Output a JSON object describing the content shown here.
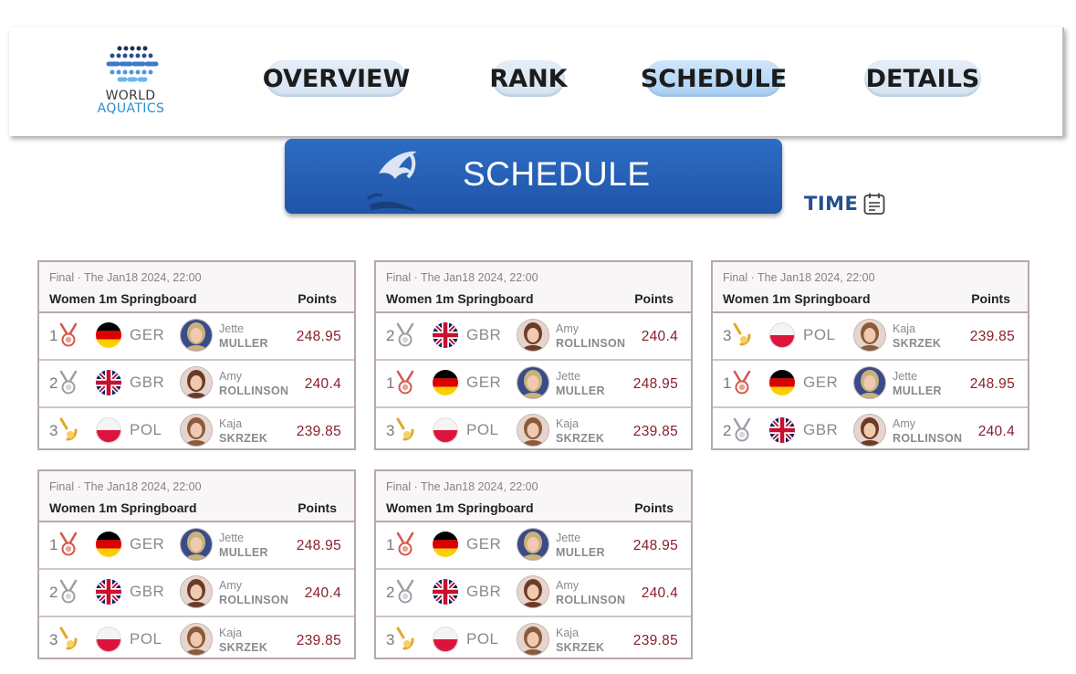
{
  "header": {
    "logo_line1": "WORLD",
    "logo_line2": "AQUATICS",
    "nav": [
      {
        "label": "OVERVIEW",
        "active": false
      },
      {
        "label": "RANK",
        "active": false
      },
      {
        "label": "SCHEDULE",
        "active": true
      },
      {
        "label": "DETAILS",
        "active": false
      }
    ]
  },
  "banner": {
    "title": "SCHEDULE",
    "icon": "swimmer-logo-icon"
  },
  "sort": {
    "label": "TIME",
    "icon": "calendar-icon"
  },
  "colors": {
    "banner_blue": "#2461b6",
    "score_red": "#8a1f2c",
    "link_blue": "#24508e",
    "logo_blue": "#2a8fd6"
  },
  "cards": [
    {
      "meta": "Final · The Jan18 2024, 22:00",
      "event": "Women 1m Springboard",
      "points_header": "Points",
      "rows": [
        {
          "rank": "1",
          "medal": "bronze-medal-icon",
          "country": "GER",
          "first": "Jette",
          "last": "MULLER",
          "score": "248.95"
        },
        {
          "rank": "2",
          "medal": "silver-medal-icon",
          "country": "GBR",
          "first": "Amy",
          "last": "ROLLINSON",
          "score": "240.4"
        },
        {
          "rank": "3",
          "medal": "gold-medal-icon",
          "country": "POL",
          "first": "Kaja",
          "last": "SKRZEK",
          "score": "239.85"
        }
      ]
    },
    {
      "meta": "Final · The Jan18 2024, 22:00",
      "event": "Women 1m Springboard",
      "points_header": "Points",
      "rows": [
        {
          "rank": "2",
          "medal": "silver-medal-icon",
          "country": "GBR",
          "first": "Amy",
          "last": "ROLLINSON",
          "score": "240.4"
        },
        {
          "rank": "1",
          "medal": "bronze-medal-icon",
          "country": "GER",
          "first": "Jette",
          "last": "MULLER",
          "score": "248.95"
        },
        {
          "rank": "3",
          "medal": "gold-medal-icon",
          "country": "POL",
          "first": "Kaja",
          "last": "SKRZEK",
          "score": "239.85"
        }
      ]
    },
    {
      "meta": "Final · The Jan18 2024, 22:00",
      "event": "Women 1m Springboard",
      "points_header": "Points",
      "rows": [
        {
          "rank": "3",
          "medal": "gold-medal-icon",
          "country": "POL",
          "first": "Kaja",
          "last": "SKRZEK",
          "score": "239.85"
        },
        {
          "rank": "1",
          "medal": "bronze-medal-icon",
          "country": "GER",
          "first": "Jette",
          "last": "MULLER",
          "score": "248.95"
        },
        {
          "rank": "2",
          "medal": "silver-medal-icon",
          "country": "GBR",
          "first": "Amy",
          "last": "ROLLINSON",
          "score": "240.4"
        }
      ]
    },
    {
      "meta": "Final · The Jan18 2024, 22:00",
      "event": "Women 1m Springboard",
      "points_header": "Points",
      "rows": [
        {
          "rank": "1",
          "medal": "bronze-medal-icon",
          "country": "GER",
          "first": "Jette",
          "last": "MULLER",
          "score": "248.95"
        },
        {
          "rank": "2",
          "medal": "silver-medal-icon",
          "country": "GBR",
          "first": "Amy",
          "last": "ROLLINSON",
          "score": "240.4"
        },
        {
          "rank": "3",
          "medal": "gold-medal-icon",
          "country": "POL",
          "first": "Kaja",
          "last": "SKRZEK",
          "score": "239.85"
        }
      ]
    },
    {
      "meta": "Final · The Jan18 2024, 22:00",
      "event": "Women 1m Springboard",
      "points_header": "Points",
      "rows": [
        {
          "rank": "1",
          "medal": "bronze-medal-icon",
          "country": "GER",
          "first": "Jette",
          "last": "MULLER",
          "score": "248.95"
        },
        {
          "rank": "2",
          "medal": "silver-medal-icon",
          "country": "GBR",
          "first": "Amy",
          "last": "ROLLINSON",
          "score": "240.4"
        },
        {
          "rank": "3",
          "medal": "gold-medal-icon",
          "country": "POL",
          "first": "Kaja",
          "last": "SKRZEK",
          "score": "239.85"
        }
      ]
    }
  ]
}
